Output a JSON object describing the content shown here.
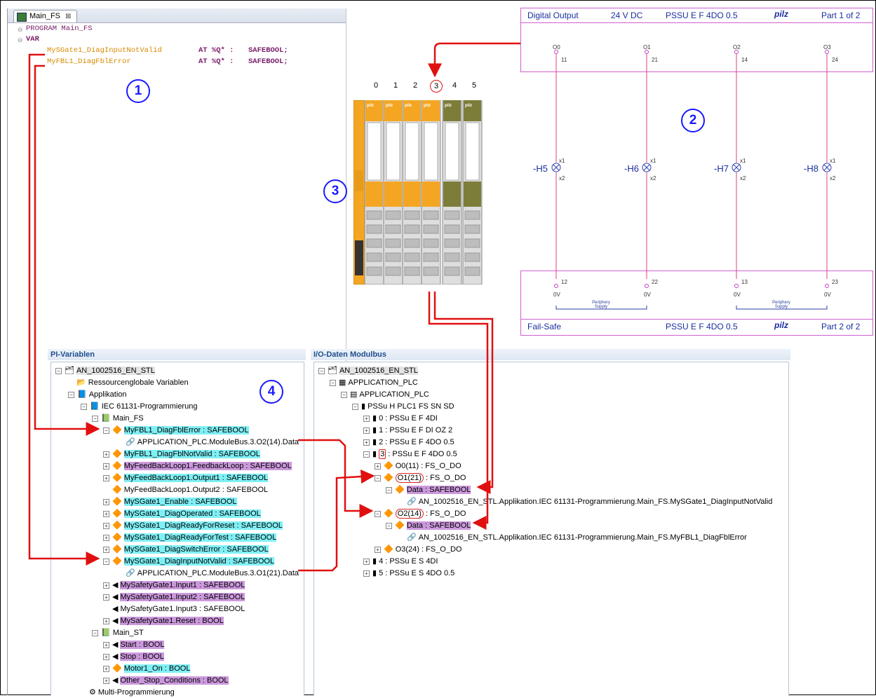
{
  "editor": {
    "tab_label": "Main_FS",
    "tab_close": "⊠",
    "lines": {
      "program": "PROGRAM Main_FS",
      "var": "VAR",
      "var1_name": "MySGate1_DiagInputNotValid",
      "var1_at": "AT %Q* :",
      "var1_type": "SAFEBOOL;",
      "var2_name": "MyFBL1_DiagFblError",
      "var2_at": "AT %Q* :",
      "var2_type": "SAFEBOOL;"
    }
  },
  "markers": {
    "m1": "1",
    "m2": "2",
    "m3": "3",
    "m4": "4"
  },
  "schematic": {
    "top": {
      "title": "Digital Output",
      "voltage": "24 V DC",
      "module": "PSSU E F 4DO 0.5",
      "brand": "pilz",
      "part": "Part 1 of 2"
    },
    "bottom": {
      "title": "Fail-Safe",
      "module": "PSSU E F 4DO 0.5",
      "brand": "pilz",
      "part": "Part 2 of 2"
    },
    "outputs": [
      {
        "name": "O0",
        "top_term": "11",
        "lamp": "-H5",
        "bot_term": "12"
      },
      {
        "name": "O1",
        "top_term": "21",
        "lamp": "-H6",
        "bot_term": "22"
      },
      {
        "name": "O2",
        "top_term": "14",
        "lamp": "-H7",
        "bot_term": "13"
      },
      {
        "name": "O3",
        "top_term": "24",
        "lamp": "-H8",
        "bot_term": "23"
      }
    ],
    "x1": "x1",
    "x2": "x2",
    "zero_v": "0V",
    "periphery": "Periphery Supply"
  },
  "rack": {
    "slots": [
      "0",
      "1",
      "2",
      "3",
      "4",
      "5"
    ],
    "selected_slot": "3",
    "brand": "pilz"
  },
  "pi_vars": {
    "title": "PI-Variablen",
    "items": {
      "root": "AN_1002516_EN_STL",
      "ressource": "Ressourcenglobale Variablen",
      "applikation": "Applikation",
      "iec": "IEC 61131-Programmierung",
      "main_fs": "Main_FS",
      "fbl_error": "MyFBL1_DiagFblError : SAFEBOOL",
      "fbl_error_child": "APPLICATION_PLC.ModuleBus.3.O2(14).Data",
      "fbl_notvalid": "MyFBL1_DiagFblNotValid : SAFEBOOL",
      "feedback": "MyFeedBackLoop1.FeedbackLoop : SAFEBOOL",
      "fb_out1": "MyFeedBackLoop1.Output1 : SAFEBOOL",
      "fb_out2": "MyFeedBackLoop1.Output2 : SAFEBOOL",
      "sg_enable": "MySGate1_Enable : SAFEBOOL",
      "sg_operated": "MySGate1_DiagOperated : SAFEBOOL",
      "sg_readyreset": "MySGate1_DiagReadyForReset : SAFEBOOL",
      "sg_readytest": "MySGate1_DiagReadyForTest : SAFEBOOL",
      "sg_switcherr": "MySGate1_DiagSwitchError : SAFEBOOL",
      "sg_inputnotvalid": "MySGate1_DiagInputNotValid : SAFEBOOL",
      "sg_inputnotvalid_child": "APPLICATION_PLC.ModuleBus.3.O1(21).Data",
      "sgate_in1": "MySafetyGate1.Input1 : SAFEBOOL",
      "sgate_in2": "MySafetyGate1.Input2 : SAFEBOOL",
      "sgate_in3": "MySafetyGate1.Input3 : SAFEBOOL",
      "sgate_reset": "MySafetyGate1.Reset : BOOL",
      "main_st": "Main_ST",
      "start": "Start : BOOL",
      "stop": "Stop : BOOL",
      "motor": "Motor1_On : BOOL",
      "other": "Other_Stop_Conditions : BOOL",
      "multi": "Multi-Programmierung"
    }
  },
  "io_data": {
    "title": "I/O-Daten Modulbus",
    "items": {
      "root": "AN_1002516_EN_STL",
      "app1": "APPLICATION_PLC",
      "app2": "APPLICATION_PLC",
      "head": "PSSu H PLC1 FS SN SD",
      "m0": "0 : PSSu E F 4DI",
      "m1": "1 : PSSu E F DI OZ 2",
      "m2": "2 : PSSu E F 4DO 0.5",
      "m3_num": "3",
      "m3_rest": ": PSSu E F 4DO 0.5",
      "o0": "O0(11) : FS_O_DO",
      "o1_name": "O1(21)",
      "o1_rest": ": FS_O_DO",
      "o1_data": "Data : SAFEBOOL",
      "o1_link": "AN_1002516_EN_STL.Applikation.IEC 61131-Programmierung.Main_FS.MySGate1_DiagInputNotValid",
      "o2_name": "O2(14)",
      "o2_rest": ": FS_O_DO",
      "o2_data": "Data : SAFEBOOL",
      "o2_link": "AN_1002516_EN_STL.Applikation.IEC 61131-Programmierung.Main_FS.MyFBL1_DiagFblError",
      "o3": "O3(24) : FS_O_DO",
      "m4": "4 : PSSu E S 4DI",
      "m5": "5 : PSSu E S 4DO 0.5"
    }
  },
  "colors": {
    "arrow": "#e01010",
    "accent": "#1a1aff",
    "schematic_line": "#e0407a",
    "schematic_box": "#d060d0",
    "highlight_cyan": "#7ff0f5",
    "highlight_pink": "#cc99dd"
  }
}
